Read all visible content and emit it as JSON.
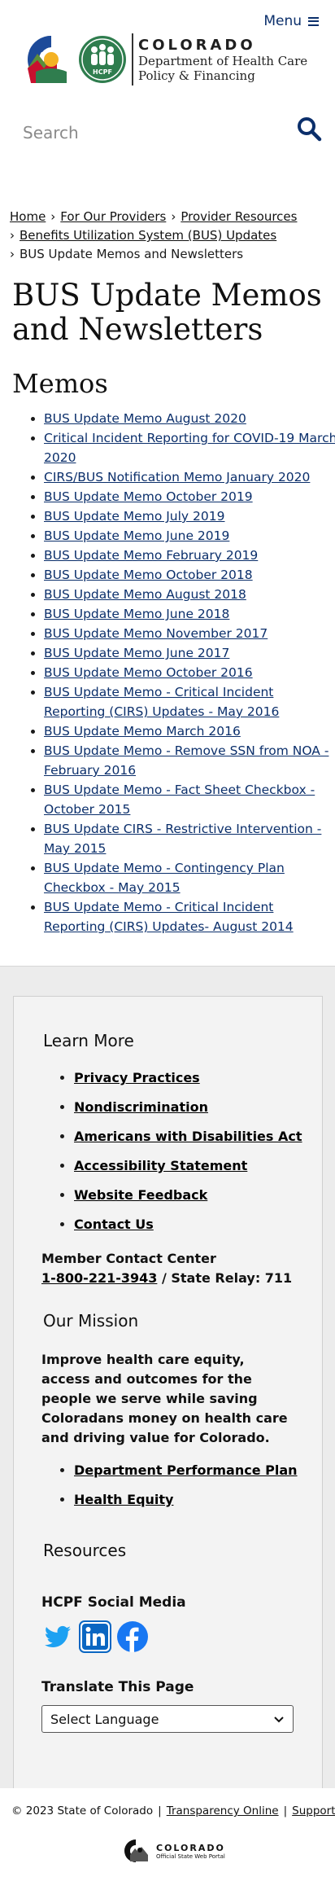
{
  "header": {
    "menu_label": "Menu",
    "co_word": "COLORADO",
    "dept_line1": "Department of Health Care",
    "dept_line2": "Policy & Financing",
    "hcpf_badge": "HCPF"
  },
  "search": {
    "placeholder": "Search"
  },
  "breadcrumbs": {
    "home": "Home",
    "providers": "For Our Providers",
    "resources": "Provider Resources",
    "bus": "Benefits Utilization System (BUS) Updates",
    "current": "BUS Update Memos and Newsletters"
  },
  "page": {
    "title": "BUS Update Memos and Newsletters",
    "section": "Memos"
  },
  "memos": [
    "BUS Update Memo August 2020",
    "Critical Incident Reporting for COVID-19 March 2020",
    "CIRS/BUS Notification Memo January 2020",
    "BUS Update Memo October 2019",
    "BUS Update Memo July 2019",
    "BUS Update Memo June 2019",
    "BUS Update Memo February 2019",
    "BUS Update Memo October 2018",
    "BUS Update Memo August 2018",
    "BUS Update Memo June 2018",
    "BUS Update Memo November 2017",
    "BUS Update Memo June 2017",
    "BUS Update Memo October 2016",
    "BUS Update Memo - Critical Incident Reporting (CIRS) Updates - May 2016",
    "BUS Update Memo March 2016",
    "BUS Update Memo - Remove SSN from NOA - February 2016",
    "BUS Update Memo - Fact Sheet Checkbox - October 2015",
    "BUS Update CIRS - Restrictive Intervention - May 2015",
    "BUS Update Memo - Contingency Plan Checkbox - May 2015",
    "BUS Update Memo - Critical Incident Reporting (CIRS) Updates- August 2014"
  ],
  "footer": {
    "learn_more": "Learn More",
    "learn_links": [
      "Privacy Practices",
      "Nondiscrimination",
      "Americans with Disabilities Act",
      "Accessibility Statement",
      "Website Feedback",
      "Contact Us"
    ],
    "contact_center": "Member Contact Center",
    "contact_phone": "1-800-221-3943",
    "state_relay": "/ State Relay: 711",
    "mission_title": "Our Mission",
    "mission_text": "Improve health care equity, access and outcomes for the people we serve while saving Coloradans money on health care and driving value for Colorado.",
    "mission_links": [
      "Department Performance Plan",
      "Health Equity"
    ],
    "resources_title": "Resources",
    "social_title": "HCPF Social Media",
    "translate_title": "Translate This Page",
    "select_language": "Select Language"
  },
  "bottom": {
    "copyright": "© 2023 State of Colorado",
    "transparency": "Transparency Online",
    "support": "Support",
    "portal_big": "COLORADO",
    "portal_small": "Official State Web Portal"
  },
  "colors": {
    "link_blue": "#0b2f6b",
    "co_red": "#c8102e",
    "co_blue": "#1d4a99",
    "co_gold": "#f4b223",
    "hcpf_green": "#2f7d4e",
    "twitter": "#1da1f2",
    "linkedin": "#0a66c2",
    "facebook": "#1877f2"
  }
}
